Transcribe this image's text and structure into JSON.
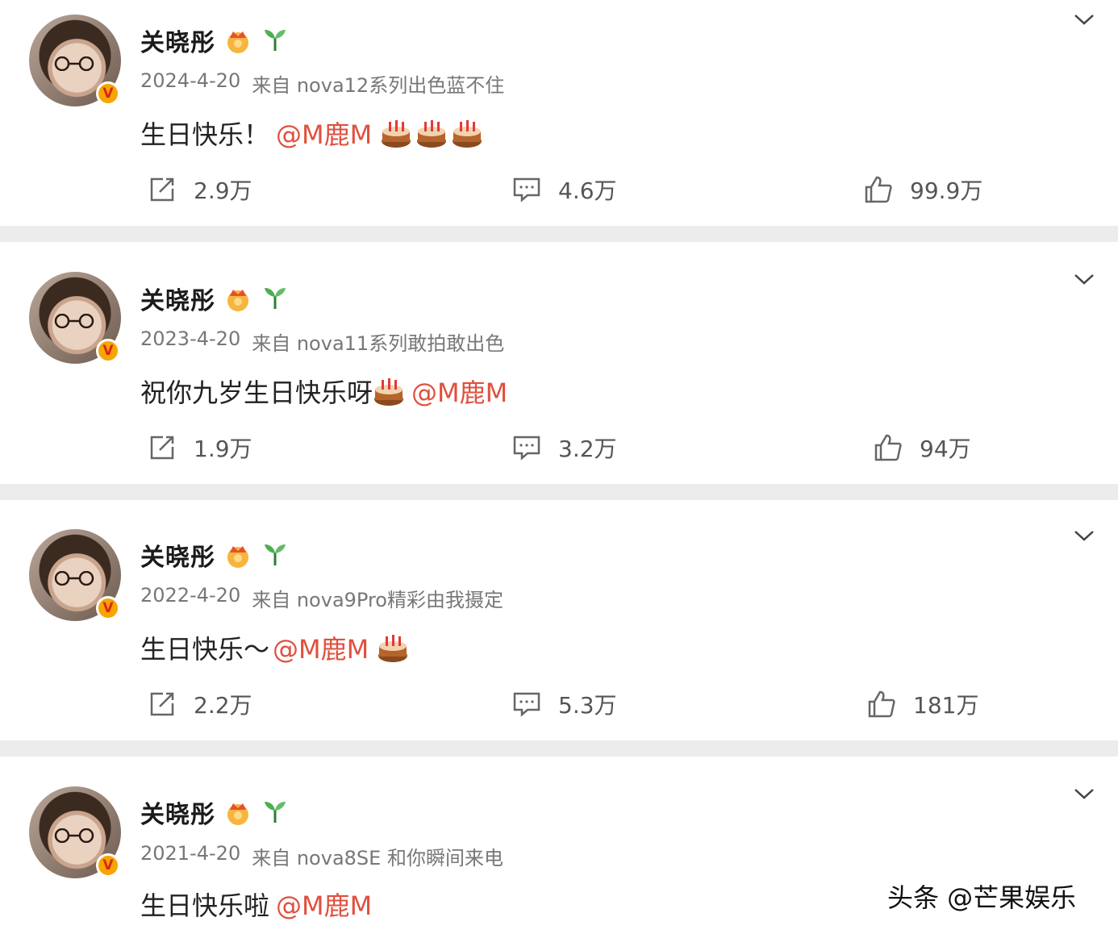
{
  "posts": [
    {
      "username": "关晓彤",
      "date": "2024-4-20",
      "source": "来自 nova12系列出色蓝不住",
      "text": "生日快乐！",
      "mention": "@M鹿M",
      "cakes": 3,
      "reposts": "2.9万",
      "comments": "4.6万",
      "likes": "99.9万"
    },
    {
      "username": "关晓彤",
      "date": "2023-4-20",
      "source": "来自 nova11系列敢拍敢出色",
      "text": "祝你九岁生日快乐呀",
      "mention": "@M鹿M",
      "cakes": 1,
      "reposts": "1.9万",
      "comments": "3.2万",
      "likes": "94万"
    },
    {
      "username": "关晓彤",
      "date": "2022-4-20",
      "source": "来自 nova9Pro精彩由我摄定",
      "text": "生日快乐～",
      "mention": "@M鹿M",
      "cakes": 1,
      "reposts": "2.2万",
      "comments": "5.3万",
      "likes": "181万"
    },
    {
      "username": "关晓彤",
      "date": "2021-4-20",
      "source": "来自 nova8SE 和你瞬间来电",
      "text": "生日快乐啦",
      "mention": "@M鹿M",
      "cakes": 0,
      "reposts": "",
      "comments": "",
      "likes": ""
    }
  ],
  "watermark": "头条 @芒果娱乐",
  "icons": {
    "badge": "crown-badge-icon",
    "sprout": "sprout-icon",
    "verified": "verified-v-icon",
    "repost": "repost-icon",
    "comment": "comment-icon",
    "like": "thumbs-up-icon",
    "more": "chevron-down-icon",
    "cake": "birthday-cake-emoji"
  },
  "colors": {
    "mention": "#e0503f",
    "verified": "#f7a500",
    "divider": "#ececec"
  }
}
